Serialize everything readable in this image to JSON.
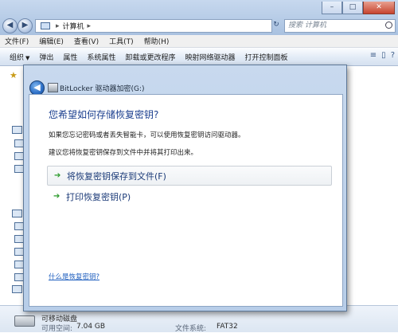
{
  "explorer": {
    "address_path": "计算机",
    "search_placeholder": "搜索 计算机",
    "menu": [
      "文件(F)",
      "编辑(E)",
      "查看(V)",
      "工具(T)",
      "帮助(H)"
    ],
    "toolbar": [
      "组织",
      "弹出",
      "属性",
      "系统属性",
      "卸载或更改程序",
      "映射网络驱动器",
      "打开控制面板"
    ]
  },
  "status": {
    "drive_label": "可移动磁盘",
    "free_space_label": "可用空间:",
    "free_space_value": "7.04 GB",
    "filesystem_label": "文件系统:",
    "filesystem_value": "FAT32"
  },
  "dialog": {
    "title": "BitLocker 驱动器加密(G:)",
    "heading": "您希望如何存储恢复密钥?",
    "line1": "如果您忘记密码或者丢失智能卡，可以使用恢复密钥访问驱动器。",
    "line2": "建议您将恢复密钥保存到文件中并将其打印出来。",
    "options": [
      {
        "label": "将恢复密钥保存到文件(F)"
      },
      {
        "label": "打印恢复密钥(P)"
      }
    ],
    "help_link": "什么是恢复密钥?"
  },
  "icons": {
    "back": "back-arrow-icon",
    "forward": "forward-arrow-icon",
    "option_arrow": "green-arrow-icon",
    "drive": "removable-drive-icon"
  }
}
